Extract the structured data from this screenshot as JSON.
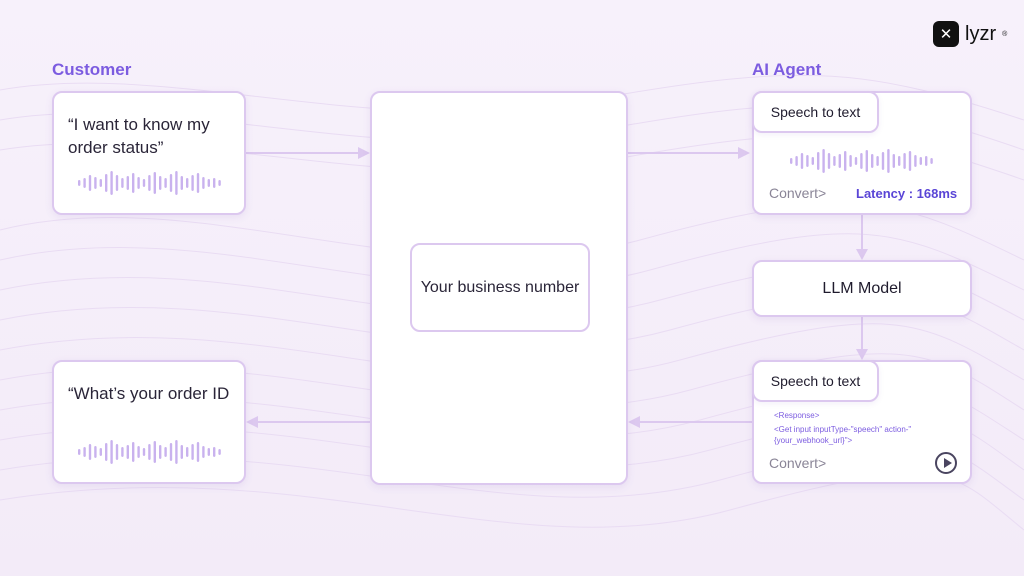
{
  "brand": {
    "name": "lyzr",
    "mark": "✕",
    "trademark": "®"
  },
  "customer": {
    "title": "Customer",
    "message_in": "“I want to know my order status”",
    "message_out": "“What’s your order ID"
  },
  "business": {
    "label": "Your business number"
  },
  "agent": {
    "title": "AI Agent",
    "stt": {
      "label": "Speech to text",
      "convert": "Convert>",
      "latency": "Latency : 168ms"
    },
    "llm": {
      "label": "LLM Model"
    },
    "tts": {
      "label": "Speech to text",
      "code_line1": "<Response>",
      "code_line2": "<Get input inputType-\"speech\" action-\"",
      "code_line3": "{your_webhook_url}\">",
      "convert": "Convert>"
    }
  },
  "colors": {
    "accent": "#7c5ce0",
    "border": "#dcc8ef",
    "arrow": "#dcc8ef",
    "wave": "#c9b2ee",
    "latency": "#5a45d6"
  },
  "icons": {
    "play": "play-icon",
    "waveform": "waveform-icon",
    "logo": "lyzr-logo-icon"
  }
}
